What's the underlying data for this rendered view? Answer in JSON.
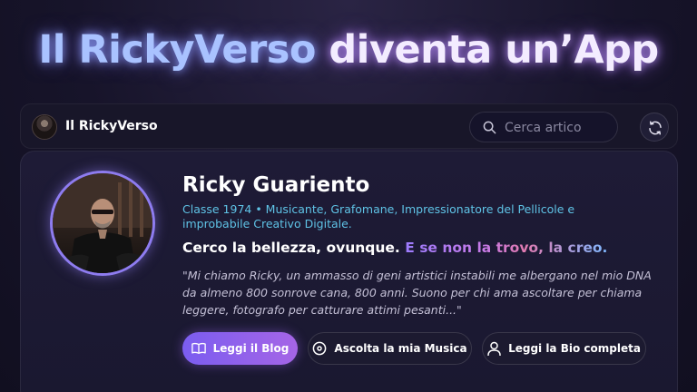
{
  "headline": {
    "brand": "Il RickyVerso",
    "rest": " diventa un’App"
  },
  "topbar": {
    "site_name": "Il RickyVerso",
    "search_placeholder": "Cerca artico",
    "logo_icon": "avatar-logo",
    "search_icon": "search-icon",
    "refresh_icon": "refresh-icon"
  },
  "profile": {
    "name": "Ricky Guariento",
    "subtitle": "Classe 1974 • Musicante, Grafomane, Impressionatore del Pellicole e improbabile Creativo Digitale.",
    "motto_part1": "Cerco la bellezza, ovunque.",
    "motto_part2": " E se non la trovo, la creo.",
    "quote": "\"Mi chiamo Ricky, un ammasso di geni artistici instabili me albergano nel mio DNA da almeno 800 sonrove cana, 800 anni. Suono per chi ama ascoltare per chiama leggere, fotografo per catturare attimi pesanti...\""
  },
  "buttons": {
    "blog": "Leggi il Blog",
    "music": "Ascolta la mia Musica",
    "bio": "Leggi la Bio completa"
  },
  "colors": {
    "accent": "#7b5df0",
    "subtitle": "#5fc3e6",
    "background": "#17142a"
  }
}
